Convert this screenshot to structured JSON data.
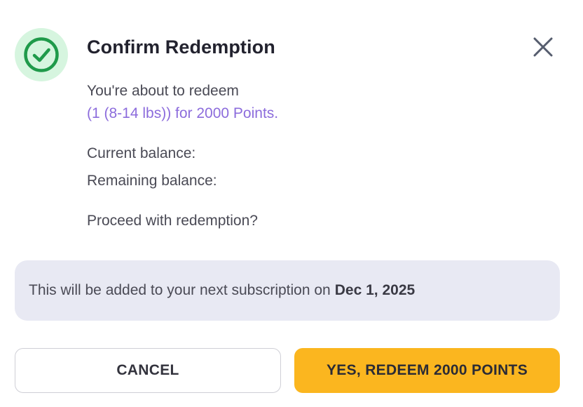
{
  "dialog": {
    "title": "Confirm Redemption",
    "intro": "You're about to redeem",
    "item_line": "(1 (8-14 lbs)) for 2000 Points.",
    "current_balance_label": "Current balance:",
    "remaining_balance_label": "Remaining balance:",
    "question": "Proceed with redemption?",
    "notice_text": "This will be added to your next subscription on",
    "notice_date": "Dec 1, 2025",
    "cancel_label": "CANCEL",
    "confirm_label": "YES, REDEEM 2000 POINTS"
  },
  "icons": {
    "status": "check-circle-icon",
    "close": "close-icon"
  },
  "colors": {
    "accent_purple": "#8c6cdc",
    "confirm_yellow": "#fbb61f",
    "success_green": "#1f9a4a",
    "success_bg": "#d6f5df",
    "notice_bg": "#e8e9f3"
  }
}
